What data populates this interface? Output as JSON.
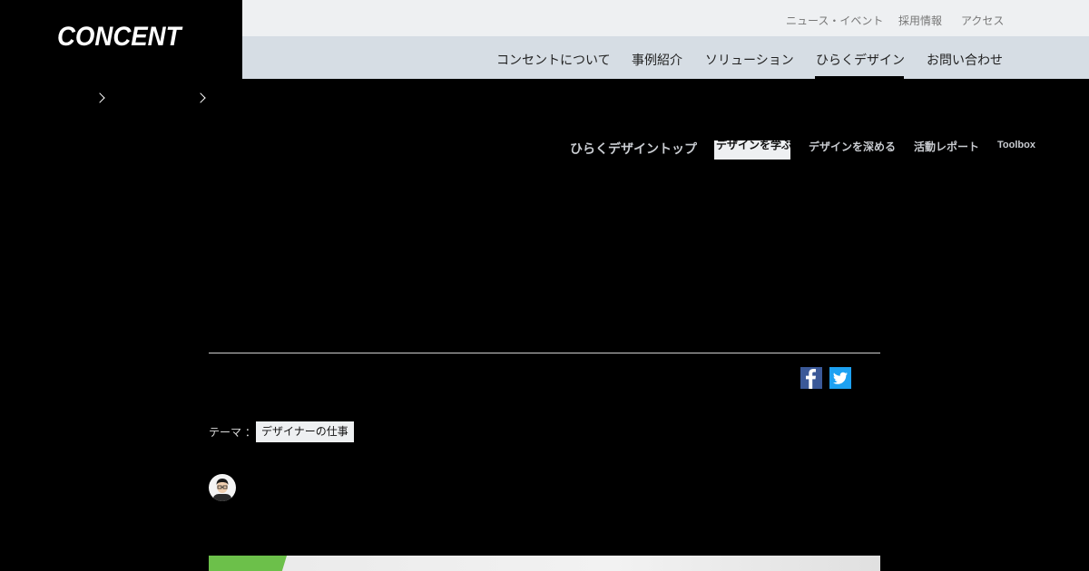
{
  "brand": {
    "logo": "CONCENT"
  },
  "top_links": [
    "ニュース・イベント",
    "採用情報",
    "アクセス"
  ],
  "main_nav": [
    "コンセントについて",
    "事例紹介",
    "ソリューション",
    "ひらくデザイン",
    "お問い合わせ"
  ],
  "main_nav_active": "ひらくデザイン",
  "sub_nav": {
    "top": "ひらくデザイントップ",
    "manabu": "デザインを学ぶ",
    "fukameru": "デザインを深める",
    "report": "活動レポート",
    "toolbox": "Toolbox"
  },
  "theme": {
    "label": "テーマ ：",
    "tag": "デザイナーの仕事"
  },
  "colors": {
    "accent_green": "#6cc04a",
    "facebook": "#3b5998",
    "twitter": "#1da1f2"
  },
  "icons": [
    "facebook-icon",
    "twitter-icon",
    "chevron-right-icon"
  ]
}
